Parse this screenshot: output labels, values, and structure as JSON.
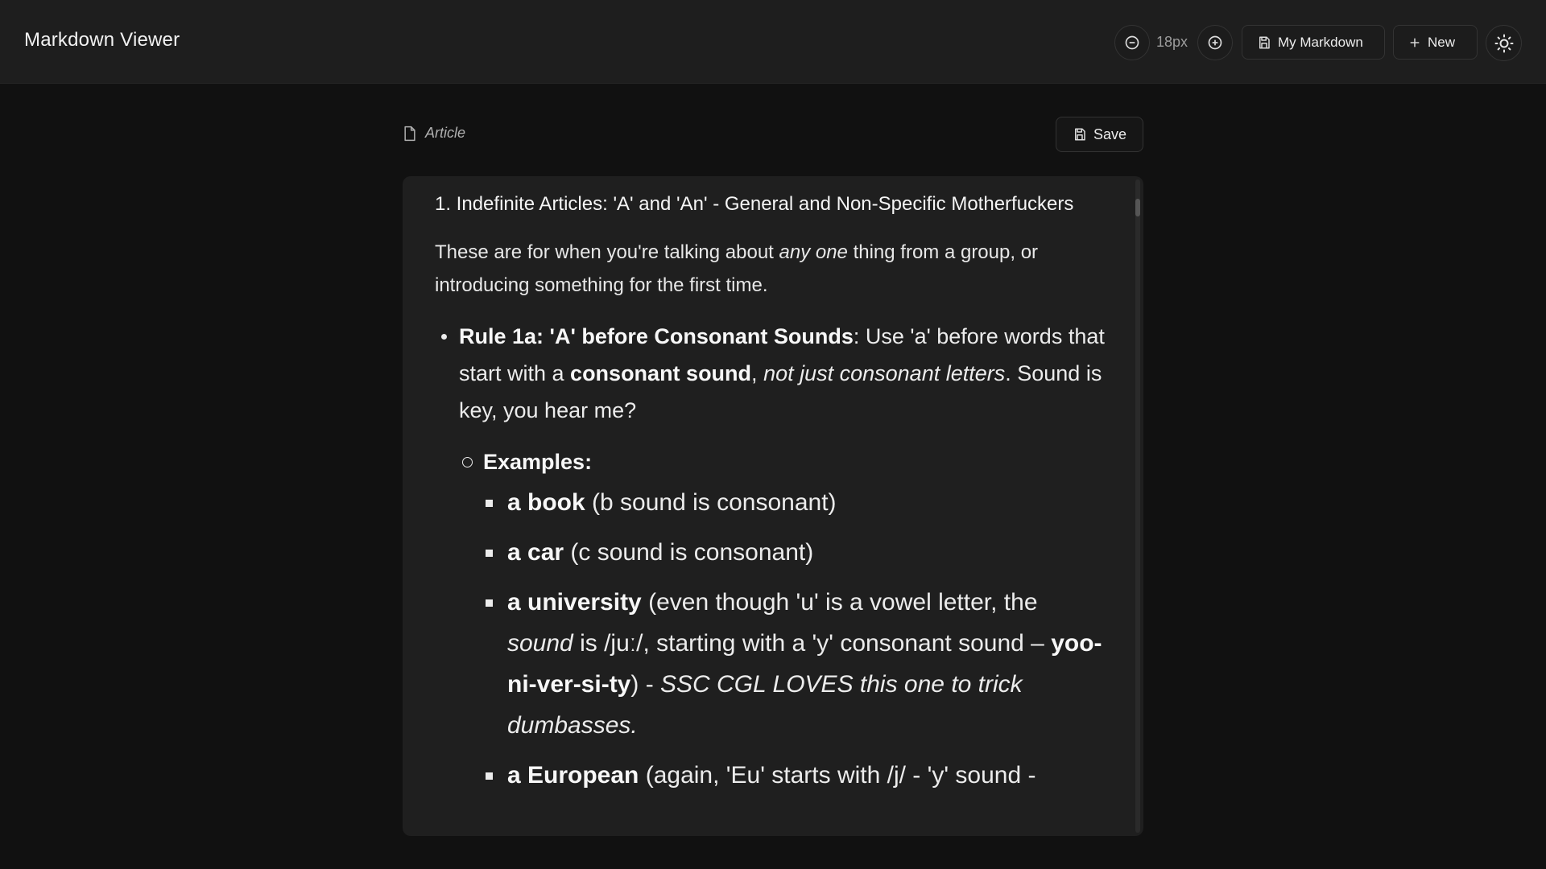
{
  "app": {
    "title": "Markdown Viewer"
  },
  "toolbar": {
    "zoom_out_icon": "minus-circle-icon",
    "font_size": "18px",
    "zoom_in_icon": "plus-circle-icon",
    "my_markdown_label": "My Markdown",
    "new_label": "New",
    "theme_icon": "sun-icon"
  },
  "document": {
    "name": "Article",
    "save_label": "Save"
  },
  "article": {
    "heading": "1. Indefinite Articles: 'A' and 'An' - General and Non-Specific Motherfuckers",
    "intro": {
      "a": "These are for when you're talking about ",
      "em": "any one",
      "b": " thing from a group, or introducing something for the first time."
    },
    "rule1a": {
      "strong1": "Rule 1a: 'A' before Consonant Sounds",
      "t1": ": Use 'a' before words that start with a ",
      "strong2": "consonant sound",
      "t2": ", ",
      "em1": "not just consonant letters",
      "t3": ". Sound is key, you hear me?"
    },
    "examples_label": "Examples:",
    "ex1": {
      "strong": "a book",
      "text": " (b sound is consonant)"
    },
    "ex2": {
      "strong": "a car",
      "text": " (c sound is consonant)"
    },
    "ex3": {
      "strong1": "a university",
      "t1": " (even though 'u' is a vowel letter, the ",
      "em1": "sound",
      "t2": " is /juː/, starting with a 'y' consonant sound – ",
      "strong2": "yoo-ni-ver-si-ty",
      "t3": ") - ",
      "em2": "SSC CGL LOVES this one to trick dumbasses."
    },
    "ex4": {
      "strong": "a European",
      "text": " (again, 'Eu' starts with /j/ - 'y' sound -"
    }
  }
}
